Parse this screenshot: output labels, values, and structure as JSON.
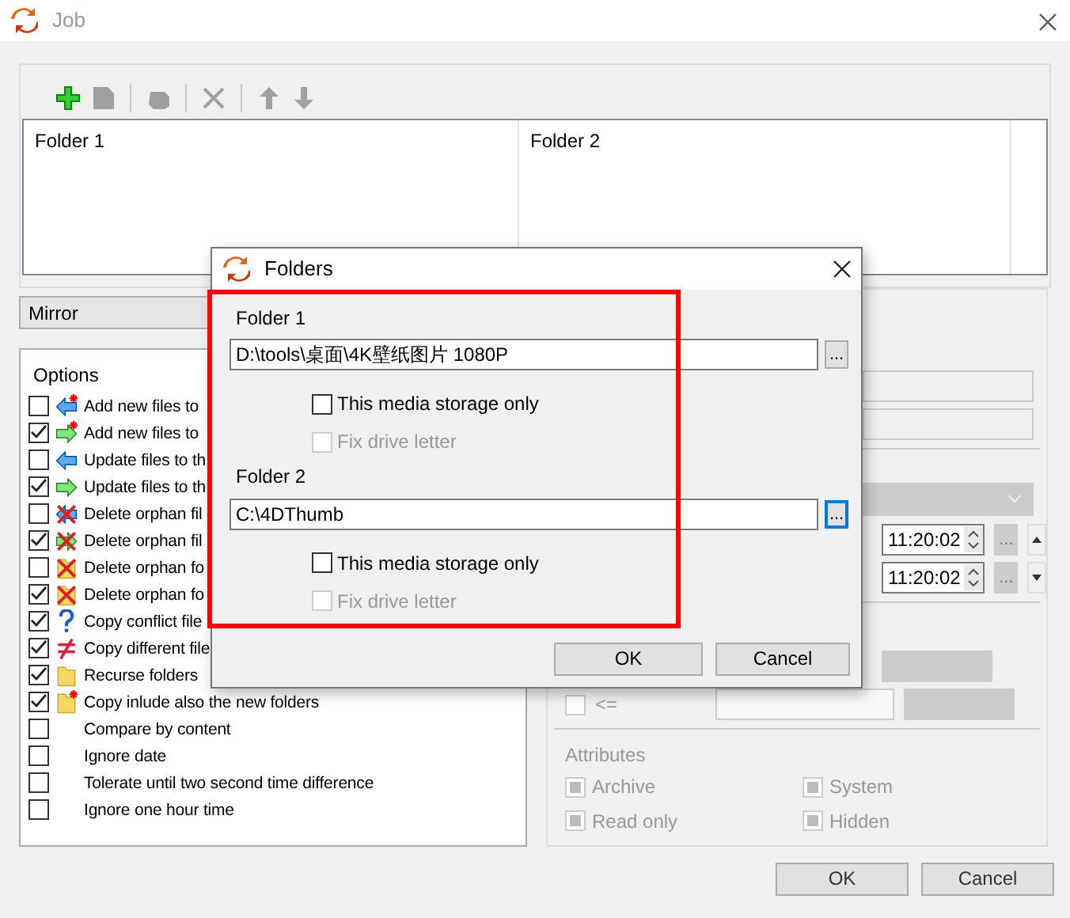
{
  "window": {
    "title": "Job"
  },
  "toolbar": [
    {
      "kind": "add",
      "disabled": false,
      "separator_before": false
    },
    {
      "kind": "edit",
      "disabled": true,
      "separator_before": false
    },
    {
      "kind": "blob",
      "disabled": true,
      "separator_before": true
    },
    {
      "kind": "delete",
      "disabled": true,
      "separator_before": true
    },
    {
      "kind": "up",
      "disabled": true,
      "separator_before": true
    },
    {
      "kind": "down",
      "disabled": true,
      "separator_before": false
    }
  ],
  "folder_list": {
    "columns": [
      "Folder 1",
      "Folder 2"
    ]
  },
  "mode": {
    "value": "Mirror"
  },
  "options": {
    "title": "Options",
    "items": [
      {
        "label": "Add new files to",
        "checked": false,
        "kind": "arrow-left",
        "new": true
      },
      {
        "label": "Add new files to",
        "checked": true,
        "kind": "arrow-right",
        "new": true
      },
      {
        "label": "Update files to th",
        "checked": false,
        "kind": "arrow-left",
        "new": false
      },
      {
        "label": "Update files to th",
        "checked": true,
        "kind": "arrow-right",
        "new": false
      },
      {
        "label": "Delete orphan fil",
        "checked": false,
        "kind": "delete-left",
        "new": false
      },
      {
        "label": "Delete orphan fil",
        "checked": true,
        "kind": "delete-right",
        "new": false
      },
      {
        "label": "Delete orphan fo",
        "checked": false,
        "kind": "delete-folder",
        "new": false
      },
      {
        "label": "Delete orphan fo",
        "checked": true,
        "kind": "delete-folder",
        "new": false
      },
      {
        "label": "Copy conflict file",
        "checked": true,
        "kind": "question",
        "new": false
      },
      {
        "label": "Copy different file",
        "checked": true,
        "kind": "not-equal",
        "new": false
      },
      {
        "label": "Recurse folders",
        "checked": true,
        "kind": "folder",
        "new": false
      },
      {
        "label": "Copy inlude also the new folders",
        "checked": true,
        "kind": "folder",
        "new": true
      },
      {
        "label": "Compare by content",
        "checked": false,
        "kind": "plain",
        "new": false
      },
      {
        "label": "Ignore date",
        "checked": false,
        "kind": "plain",
        "new": false
      },
      {
        "label": "Tolerate until two second time difference",
        "checked": false,
        "kind": "plain",
        "new": false
      },
      {
        "label": "Ignore one hour time",
        "checked": false,
        "kind": "plain",
        "new": false
      }
    ]
  },
  "filters": {
    "time_rows": [
      {
        "time": "11:20:02",
        "browse": "...",
        "kind": "up"
      },
      {
        "time": "11:20:02",
        "browse": "...",
        "kind": "down"
      }
    ],
    "size_row": {
      "operator": "<=",
      "checked": false
    }
  },
  "attributes": {
    "title": "Attributes",
    "items": [
      {
        "label": "Archive",
        "indeterminate": true
      },
      {
        "label": "System",
        "indeterminate": true
      },
      {
        "label": "Read only",
        "indeterminate": true
      },
      {
        "label": "Hidden",
        "indeterminate": true
      }
    ]
  },
  "buttons": [
    "OK",
    "Cancel"
  ],
  "dialog": {
    "title": "Folders",
    "folders": [
      {
        "label": "Folder 1",
        "path": "D:\\tools\\桌面\\4K壁纸图片 1080P",
        "browse": "...",
        "browse_focused": false,
        "media_label": "This media storage only",
        "media_only": false,
        "fix_label": "Fix drive letter",
        "fix_drive": false
      },
      {
        "label": "Folder 2",
        "path": "C:\\4DThumb",
        "browse": "...",
        "browse_focused": true,
        "media_label": "This media storage only",
        "media_only": false,
        "fix_label": "Fix drive letter",
        "fix_drive": false
      }
    ],
    "buttons": [
      "OK",
      "Cancel"
    ]
  }
}
